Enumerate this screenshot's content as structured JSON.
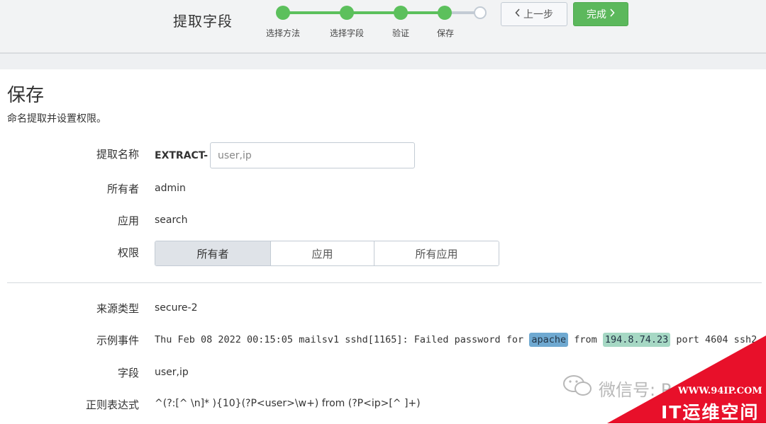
{
  "header": {
    "title": "提取字段",
    "steps": [
      {
        "label": "选择方法",
        "done": true
      },
      {
        "label": "选择字段",
        "done": true
      },
      {
        "label": "验证",
        "done": true
      },
      {
        "label": "保存",
        "done": true
      },
      {
        "label": "",
        "done": false
      }
    ],
    "prev_label": "上一步",
    "done_label": "完成"
  },
  "page": {
    "title": "保存",
    "subtitle": "命名提取并设置权限。"
  },
  "form": {
    "name_label": "提取名称",
    "name_prefix": "EXTRACT-",
    "name_value": "user,ip",
    "owner_label": "所有者",
    "owner_value": "admin",
    "app_label": "应用",
    "app_value": "search",
    "perm_label": "权限",
    "perm_options": [
      "所有者",
      "应用",
      "所有应用"
    ],
    "perm_selected": "所有者"
  },
  "details": {
    "sourcetype_label": "来源类型",
    "sourcetype_value": "secure-2",
    "event_label": "示例事件",
    "event_before": "Thu Feb 08 2022 00:15:05 mailsv1 sshd[1165]: Failed password for ",
    "event_user": "apache",
    "event_mid": " from ",
    "event_ip": "194.8.74.23",
    "event_after": " port 4604 ssh2",
    "fields_label": "字段",
    "fields_value": "user,ip",
    "regex_label": "正则表达式",
    "regex_value": "^(?:[^ \\n]* ){10}(?P<user>\\w+) from (?P<ip>[^ ]+)"
  },
  "watermark": {
    "text": "微信号: P",
    "site": "WWW.94IP.COM",
    "brand": "IT运维空间"
  },
  "colors": {
    "accent_green": "#5cb85c",
    "user_highlight": "#6fa9d1",
    "ip_highlight": "#a6d8c4",
    "corner_red": "#e8102a"
  }
}
